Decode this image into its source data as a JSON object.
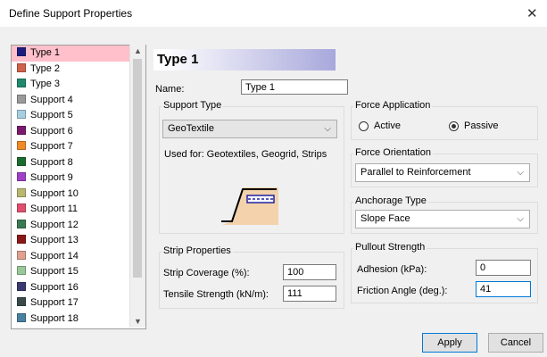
{
  "window": {
    "title": "Define Support Properties",
    "close_glyph": "✕"
  },
  "list": {
    "items": [
      {
        "label": "Type 1",
        "color": "#1c1c80",
        "selected": true
      },
      {
        "label": "Type 2",
        "color": "#d0614b"
      },
      {
        "label": "Type 3",
        "color": "#1f8a70"
      },
      {
        "label": "Support 4",
        "color": "#9a9a9a"
      },
      {
        "label": "Support 5",
        "color": "#a6cfe0"
      },
      {
        "label": "Support 6",
        "color": "#7a1a6e"
      },
      {
        "label": "Support 7",
        "color": "#f08a24"
      },
      {
        "label": "Support 8",
        "color": "#1c6b2e"
      },
      {
        "label": "Support 9",
        "color": "#a040c8"
      },
      {
        "label": "Support 10",
        "color": "#b8b870"
      },
      {
        "label": "Support 11",
        "color": "#e0506e"
      },
      {
        "label": "Support 12",
        "color": "#3a7a52"
      },
      {
        "label": "Support 13",
        "color": "#8a1818"
      },
      {
        "label": "Support 14",
        "color": "#e0a090"
      },
      {
        "label": "Support 15",
        "color": "#98c898"
      },
      {
        "label": "Support 16",
        "color": "#3a3a70"
      },
      {
        "label": "Support 17",
        "color": "#3a4a4a"
      },
      {
        "label": "Support 18",
        "color": "#4a80a0"
      }
    ]
  },
  "header": {
    "title": "Type 1"
  },
  "name": {
    "label": "Name:",
    "value": "Type 1"
  },
  "support_type": {
    "group_label": "Support Type",
    "selected": "GeoTextile",
    "used_for": "Used for: Geotextiles, Geogrid, Strips"
  },
  "strip": {
    "group_label": "Strip Properties",
    "coverage_label": "Strip Coverage (%):",
    "coverage_value": "100",
    "tensile_label": "Tensile Strength (kN/m):",
    "tensile_value": "111"
  },
  "force_application": {
    "group_label": "Force Application",
    "active_label": "Active",
    "passive_label": "Passive",
    "selected": "Passive"
  },
  "force_orientation": {
    "group_label": "Force Orientation",
    "selected": "Parallel to Reinforcement"
  },
  "anchorage": {
    "group_label": "Anchorage Type",
    "selected": "Slope Face"
  },
  "pullout": {
    "group_label": "Pullout Strength",
    "adhesion_label": "Adhesion (kPa):",
    "adhesion_value": "0",
    "friction_label": "Friction Angle (deg.):",
    "friction_value": "41"
  },
  "buttons": {
    "apply": "Apply",
    "cancel": "Cancel"
  },
  "icons": {
    "scroll_up": "▲",
    "scroll_down": "▼",
    "dropdown": "⌵"
  }
}
